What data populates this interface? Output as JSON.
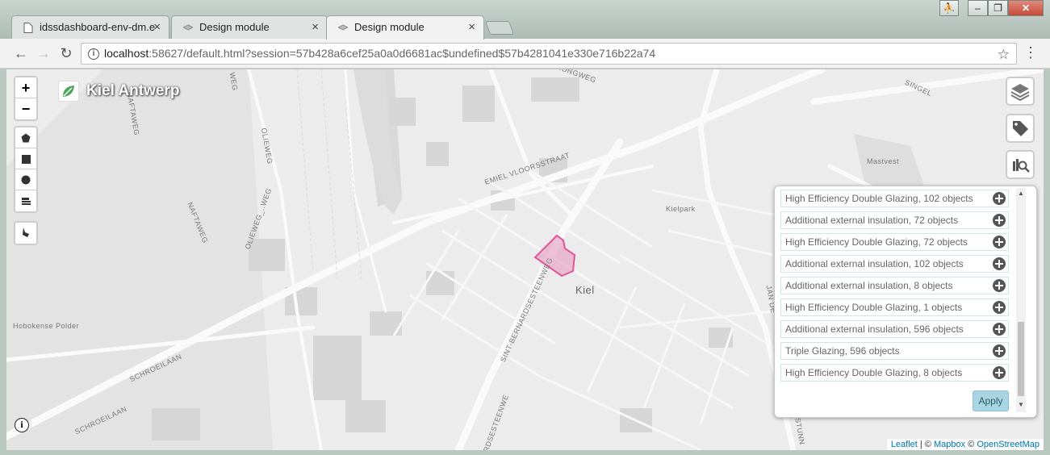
{
  "browser": {
    "tabs": [
      {
        "label": "idssdashboard-env-dm.e"
      },
      {
        "label": "Design module"
      },
      {
        "label": "Design module"
      }
    ],
    "address": {
      "host": "localhost",
      "rest": ":58627/default.html?session=57b428a6cef25a0a0d6681ac$undefined$57b4281041e330e716b22a74"
    }
  },
  "map": {
    "case_name": "Kiel Antwerp",
    "zoom_in": "+",
    "zoom_out": "−",
    "labels": {
      "olieweg": "OLIEWEG",
      "naftaweg_1": "NAFTAWEG",
      "naftaweg_2": "NAFTAWEG",
      "oliewegweg": "OLIEWEG_..WEG",
      "emiel": "EMIEL VLOORSSTRAAT",
      "singel": "SINGEL",
      "mastvest": "Mastvest",
      "kielpark": "Kielpark",
      "kiel": "Kiel",
      "sint": "SINT-BERNARDSESTEENWEG",
      "hobokense": "Hobokense Polder",
      "schroeilaan_1": "SCHROEILAAN",
      "schroeilaan_2": "SCHROEILAAN",
      "jande": "JAN DE",
      "rongweg": "RONGWEG",
      "steenwe": "NARDSESTEENWE",
      "weg_top": "WEG",
      "ostunn": "OSTUNN"
    },
    "attribution": {
      "leaflet": "Leaflet",
      "sep1": " | © ",
      "mapbox": "Mapbox",
      "sep2": " © ",
      "osm": "OpenStreetMap"
    }
  },
  "measures_panel": {
    "items": [
      {
        "label": "High Efficiency Double Glazing, 102 objects"
      },
      {
        "label": "Additional external insulation, 72 objects"
      },
      {
        "label": "High Efficiency Double Glazing, 72 objects"
      },
      {
        "label": "Additional external insulation, 102 objects"
      },
      {
        "label": "Additional external insulation, 8 objects"
      },
      {
        "label": "High Efficiency Double Glazing, 1 objects"
      },
      {
        "label": "Additional external insulation, 596 objects"
      },
      {
        "label": "Triple Glazing, 596 objects"
      },
      {
        "label": "High Efficiency Double Glazing, 8 objects"
      }
    ],
    "apply_label": "Apply"
  },
  "colors": {
    "selection": "#e0569a",
    "accent": "#a9d4e2"
  }
}
